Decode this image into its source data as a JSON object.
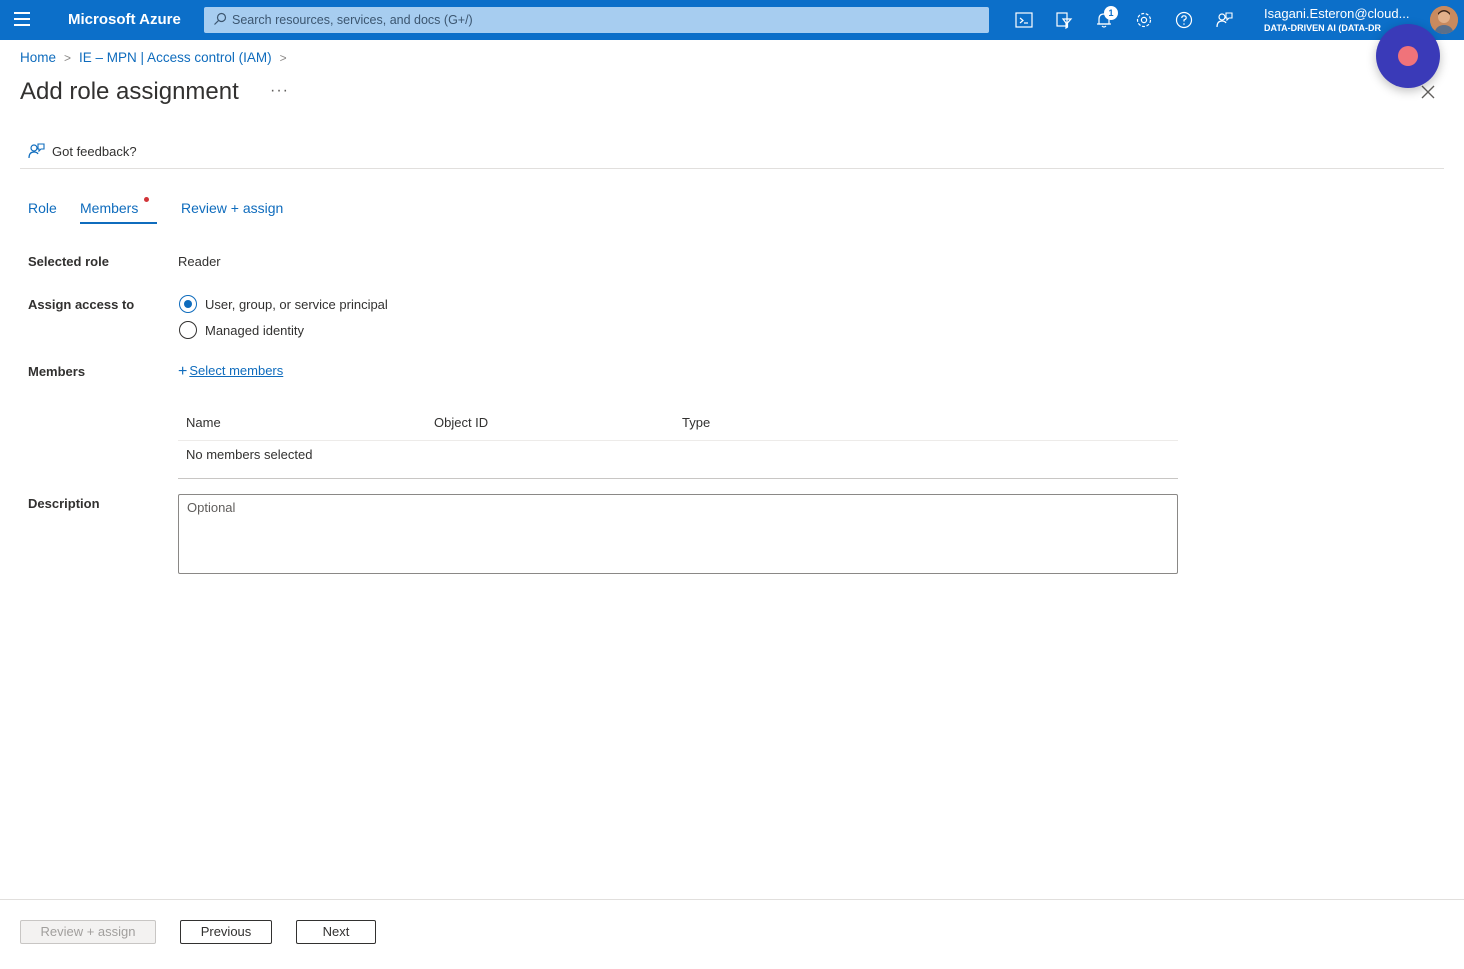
{
  "topbar": {
    "brand": "Microsoft Azure",
    "search_placeholder": "Search resources, services, and docs (G+/)",
    "notification_count": "1",
    "account_email": "Isagani.Esteron@cloud...",
    "account_org": "DATA-DRIVEN AI (DATA-DR",
    "icons": [
      "cloud-shell-icon",
      "directory-filter-icon",
      "notifications-icon",
      "settings-icon",
      "help-icon",
      "feedback-icon"
    ]
  },
  "breadcrumb": {
    "items": [
      "Home",
      "IE – MPN | Access control (IAM)"
    ]
  },
  "page": {
    "title": "Add role assignment",
    "more": "···"
  },
  "feedback": {
    "label": "Got feedback?"
  },
  "tabs": [
    {
      "label": "Role"
    },
    {
      "label": "Members"
    },
    {
      "label": "Review + assign"
    }
  ],
  "form": {
    "selected_role_label": "Selected role",
    "selected_role_value": "Reader",
    "assign_access_label": "Assign access to",
    "assign_options": [
      "User, group, or service principal",
      "Managed identity"
    ],
    "assign_selected": "User, group, or service principal",
    "members_label": "Members",
    "select_members": "Select members",
    "members_table": {
      "columns": [
        "Name",
        "Object ID",
        "Type"
      ],
      "empty_text": "No members selected"
    },
    "description_label": "Description",
    "description_placeholder": "Optional"
  },
  "footer": {
    "review_assign": "Review + assign",
    "previous": "Previous",
    "next": "Next"
  },
  "colors": {
    "topbar": "#0c6fc9",
    "accent": "#0f6cbd",
    "required_dot": "#d13438",
    "record_button": "#3a3ab8"
  }
}
